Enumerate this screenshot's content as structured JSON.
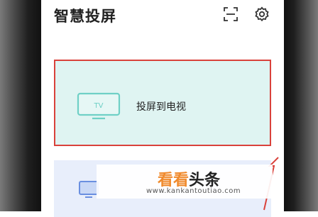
{
  "header": {
    "title": "智慧投屏"
  },
  "cast_card": {
    "label": "投屏到电视",
    "tv_text": "TV"
  },
  "watermark": {
    "logo_part1": "看看",
    "logo_part2": "头条",
    "url": "www.kankantoutiao.com"
  },
  "colors": {
    "highlight_border": "#d9423b",
    "card_bg": "#dff4f2",
    "tv_icon": "#6fd0c6",
    "next_card_bg": "#e8eefb",
    "logo_orange": "#f08a2c"
  },
  "icons": {
    "scan": "scan-icon",
    "settings": "gear-icon",
    "tv": "tv-icon",
    "monitor": "monitor-icon"
  }
}
